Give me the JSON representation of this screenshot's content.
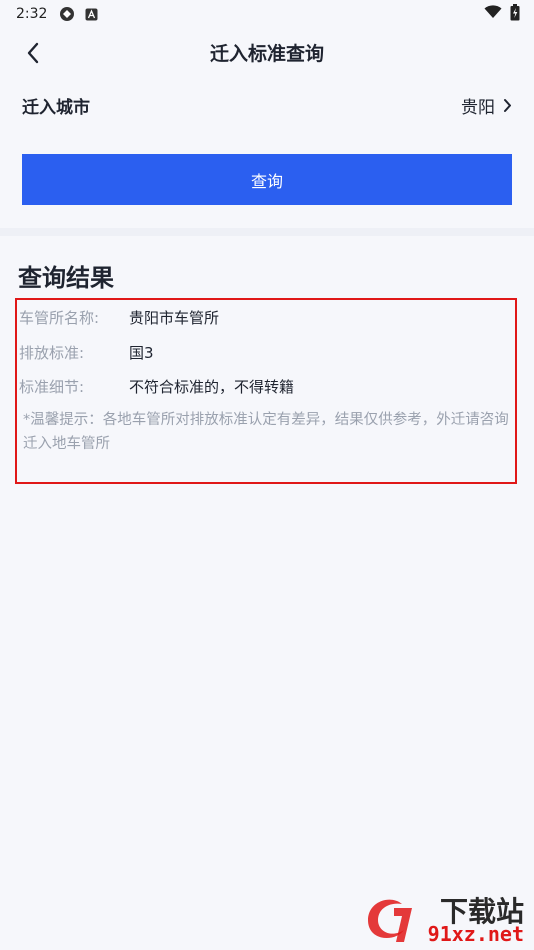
{
  "status_bar": {
    "time": "2:32"
  },
  "nav": {
    "title": "迁入标准查询"
  },
  "city": {
    "label": "迁入城市",
    "value": "贵阳"
  },
  "query_button": "查询",
  "results": {
    "title": "查询结果",
    "rows": [
      {
        "key": "车管所名称:",
        "value": "贵阳市车管所"
      },
      {
        "key": "排放标准:",
        "value": "国3"
      },
      {
        "key": "标准细节:",
        "value": "不符合标准的，不得转籍"
      }
    ],
    "tip": "*温馨提示：各地车管所对排放标准认定有差异，结果仅供参考，外迁请咨询迁入地车管所"
  },
  "watermark": {
    "brand": "下载站",
    "url": "91xz.net"
  },
  "colors": {
    "primary": "#2b5ff0",
    "highlight_border": "#e01818",
    "background": "#f6f7fb"
  }
}
